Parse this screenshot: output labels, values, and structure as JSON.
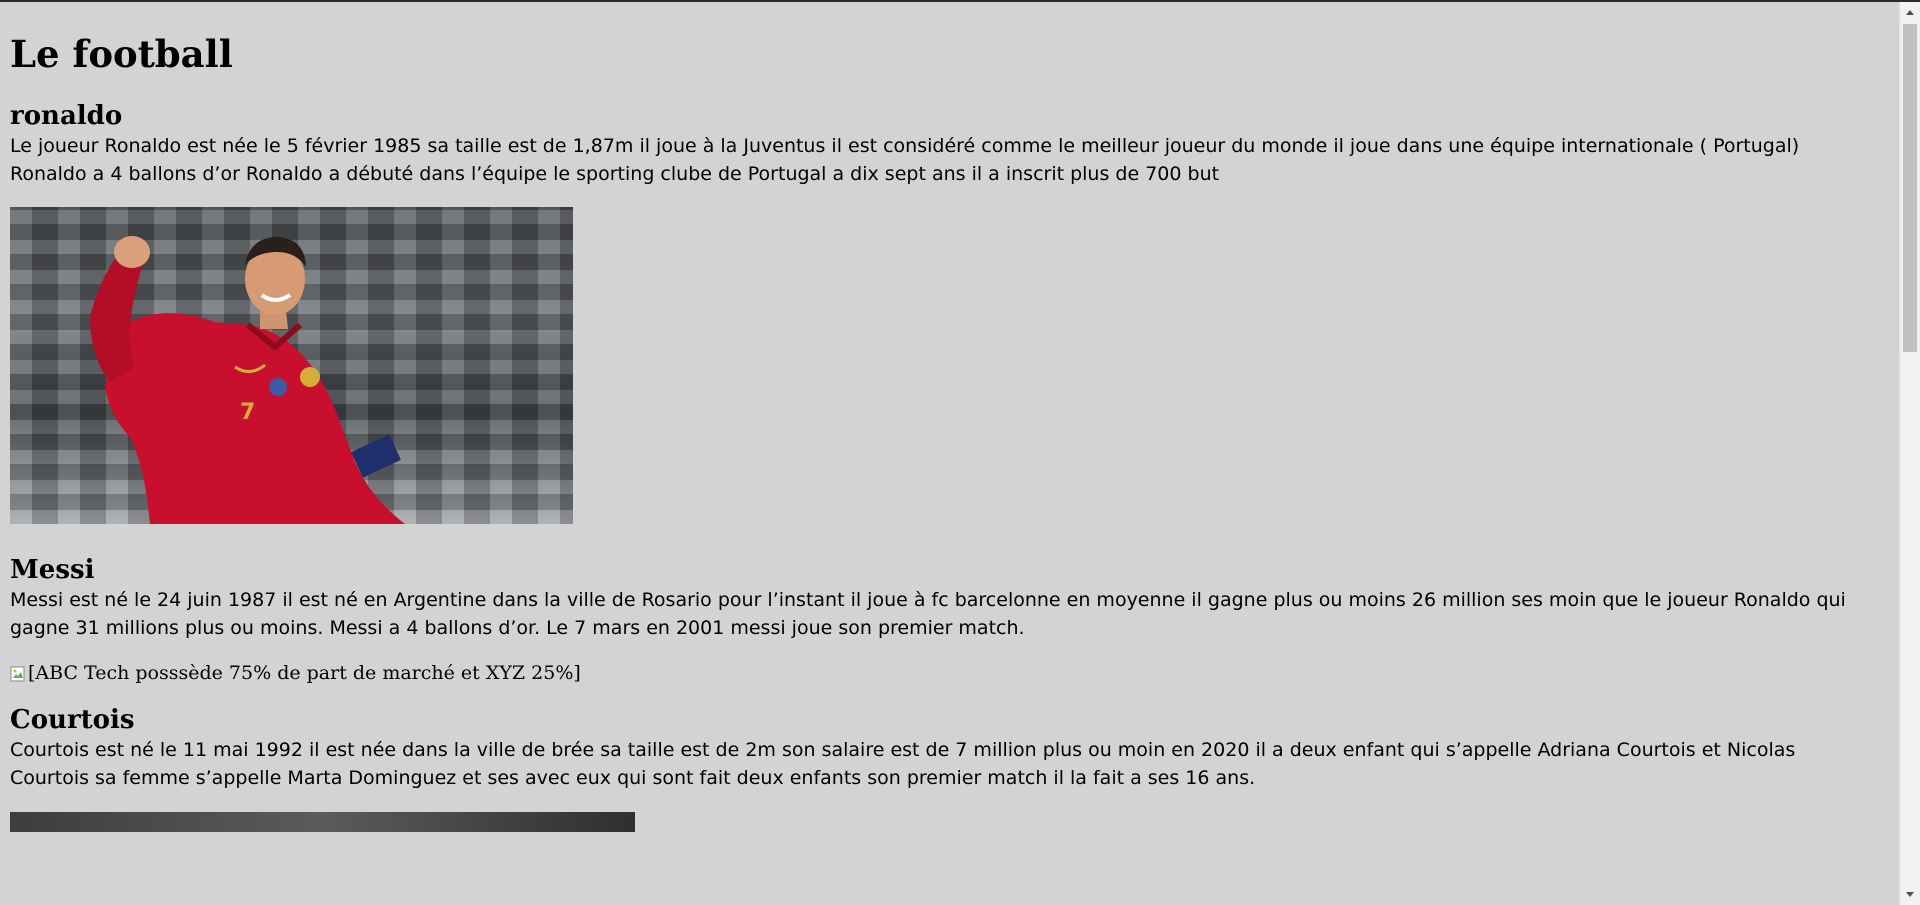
{
  "page": {
    "title": "Le football"
  },
  "sections": {
    "ronaldo": {
      "heading": "ronaldo",
      "text": "Le joueur Ronaldo est née le 5 février 1985 sa taille est de 1,87m il joue à la Juventus il est considéré comme le meilleur joueur du monde il joue dans une équipe internationale ( Portugal) Ronaldo a 4 ballons d’or Ronaldo a débuté dans l’équipe le sporting clube de Portugal a dix sept ans il a inscrit plus de 700 but",
      "jersey_number": "7"
    },
    "messi": {
      "heading": "Messi",
      "text": "Messi est né le 24 juin 1987 il est né en Argentine dans la ville de Rosario pour l’instant il joue à fc barcelonne en moyenne il gagne plus ou moins 26 million ses moin que le joueur Ronaldo qui gagne 31 millions plus ou moins. Messi a 4 ballons d’or. Le 7 mars en 2001 messi joue son premier match.",
      "broken_image_alt": "[ABC Tech posssède 75% de part de marché et XYZ 25%]"
    },
    "courtois": {
      "heading": "Courtois",
      "text": "Courtois est né le 11 mai 1992 il est née dans la ville de brée sa taille est de 2m son salaire est de 7 million plus ou moin en 2020 il a deux enfant qui s’appelle Adriana Courtois et Nicolas Courtois sa femme s’appelle Marta Dominguez et ses avec eux qui sont fait deux enfants son premier match il la fait a ses 16 ans."
    }
  },
  "colors": {
    "background": "#d3d3d3",
    "jersey_red": "#c8102e",
    "scrollbar_thumb": "#c1c1c1"
  },
  "icons": {
    "broken_image": "broken-image-icon",
    "scroll_up": "scroll-up-arrow-icon",
    "scroll_down": "scroll-down-arrow-icon"
  }
}
